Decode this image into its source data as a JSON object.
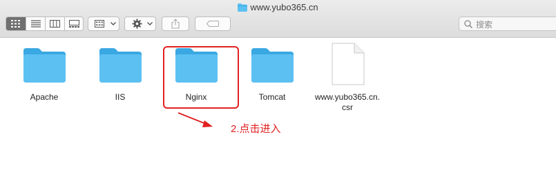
{
  "window": {
    "title": "www.yubo365.cn"
  },
  "toolbar": {
    "view_icon": "icon-view-icon",
    "view_list": "list-view-icon",
    "view_columns": "column-view-icon",
    "view_gallery": "gallery-view-icon",
    "group_by": "group-by-icon",
    "action": "gear-icon",
    "share": "share-icon",
    "tag": "tag-icon"
  },
  "search": {
    "placeholder": "搜索"
  },
  "files": [
    {
      "name": "Apache",
      "kind": "folder"
    },
    {
      "name": "IIS",
      "kind": "folder"
    },
    {
      "name": "Nginx",
      "kind": "folder"
    },
    {
      "name": "Tomcat",
      "kind": "folder"
    },
    {
      "name": "www.yubo365.cn.\ncsr",
      "kind": "document"
    }
  ],
  "annotation": {
    "text": "2.点击进入",
    "color": "#e02020"
  },
  "colors": {
    "folder": "#5cc0f2",
    "folder_dark": "#3aa8e2",
    "highlight": "#e02020"
  }
}
